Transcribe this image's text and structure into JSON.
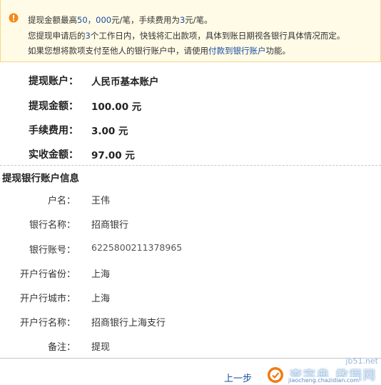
{
  "notice": {
    "line1_a": "提现金额最高",
    "line1_amount": "50，000",
    "line1_b": "元/笔，手续费用为",
    "line1_fee": "3",
    "line1_c": "元/笔。",
    "line2_a": "您提现申请后的",
    "line2_days": "3",
    "line2_b": "个工作日内，快钱将汇出款项，具体到账日期视各银行具体情况而定。",
    "line3_a": "如果您想将款项支付至他人的银行账户中，请使用",
    "line3_link": "付款到银行账户",
    "line3_b": "功能。"
  },
  "summary": [
    {
      "label": "提现账户：",
      "value": "人民币基本账户"
    },
    {
      "label": "提现金额：",
      "value": "100.00 元"
    },
    {
      "label": "手续费用：",
      "value": "3.00 元"
    },
    {
      "label": "实收金额：",
      "value": "97.00 元"
    }
  ],
  "section_title": "提现银行账户信息",
  "bank_info": [
    {
      "label": "户名：",
      "value": "王伟"
    },
    {
      "label": "银行名称：",
      "value": "招商银行"
    },
    {
      "label": "银行账号：",
      "value": "6225800211378965"
    },
    {
      "label": "开户行省份：",
      "value": "上海"
    },
    {
      "label": "开户行城市：",
      "value": "上海"
    },
    {
      "label": "开户行名称：",
      "value": "招商银行上海支行"
    },
    {
      "label": "备注：",
      "value": "提现"
    }
  ],
  "actions": {
    "prev_label": "上一步"
  },
  "watermark": {
    "domain": "jb51.net",
    "big": "查字典 教程网",
    "small": "jiaocheng.chazidian.com"
  },
  "colors": {
    "notice_bg": "#fffbe6",
    "notice_border": "#f5d688",
    "icon_orange": "#f28a1a",
    "link_blue": "#1a4ea0"
  }
}
